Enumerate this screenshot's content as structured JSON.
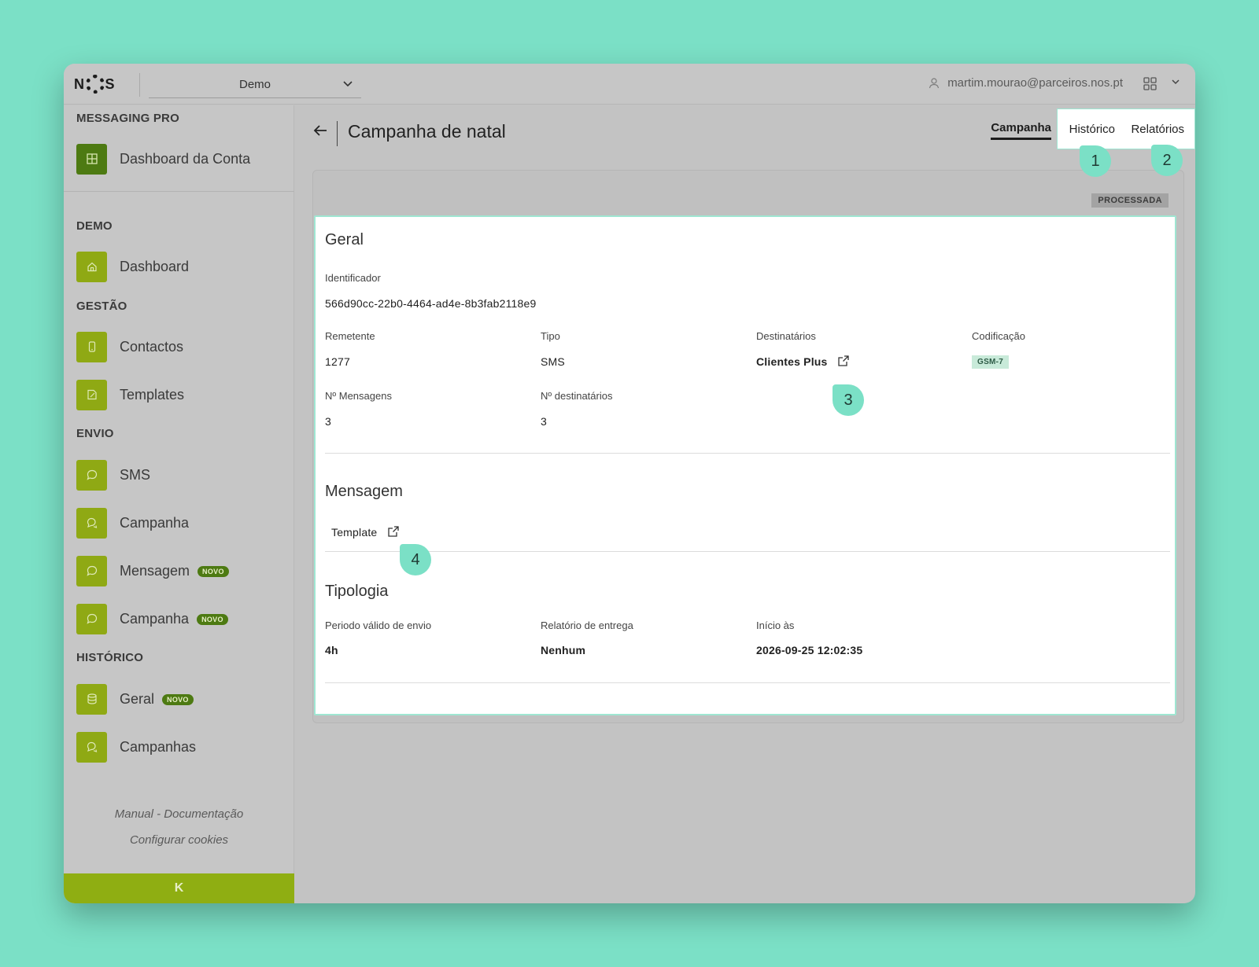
{
  "header": {
    "logo": "NOS",
    "account_select": "Demo",
    "user_email": "martim.mourao@parceiros.nos.pt"
  },
  "sidebar": {
    "top_section": "MESSAGING PRO",
    "dashboard_conta": "Dashboard da Conta",
    "demo_section": "DEMO",
    "dashboard": "Dashboard",
    "gestao_section": "GESTÃO",
    "contactos": "Contactos",
    "templates": "Templates",
    "envio_section": "ENVIO",
    "sms": "SMS",
    "campanha": "Campanha",
    "mensagem_novo": "Mensagem",
    "campanha_novo": "Campanha",
    "historico_section": "HISTÓRICO",
    "geral": "Geral",
    "campanhas": "Campanhas",
    "badge_novo": "NOVO",
    "manual_link": "Manual - Documentação",
    "cookies_link": "Configurar cookies",
    "collapse_glyph": "K"
  },
  "page": {
    "title": "Campanha de natal",
    "tabs": {
      "campanha": "Campanha",
      "historico": "Histórico",
      "relatorios": "Relatórios"
    },
    "status": "PROCESSADA"
  },
  "callouts": [
    "1",
    "2",
    "3",
    "4"
  ],
  "geral": {
    "heading": "Geral",
    "identificador_label": "Identificador",
    "identificador_value": "566d90cc-22b0-4464-ad4e-8b3fab2118e9",
    "remetente_label": "Remetente",
    "remetente_value": "1277",
    "tipo_label": "Tipo",
    "tipo_value": "SMS",
    "destinatarios_label": "Destinatários",
    "destinatarios_value": "Clientes Plus",
    "codificacao_label": "Codificação",
    "codificacao_value": "GSM-7",
    "n_mensagens_label": "Nº Mensagens",
    "n_mensagens_value": "3",
    "n_destinatarios_label": "Nº destinatários",
    "n_destinatarios_value": "3"
  },
  "mensagem": {
    "heading": "Mensagem",
    "template_link": "Template"
  },
  "tipologia": {
    "heading": "Tipologia",
    "periodo_label": "Periodo válido de envio",
    "periodo_value": "4h",
    "relatorio_label": "Relatório de entrega",
    "relatorio_value": "Nenhum",
    "inicio_label": "Início às",
    "inicio_value": "2026-09-25 12:02:35"
  },
  "colors": {
    "background": "#7be0c6",
    "accent_green": "#8fa914",
    "dark_green": "#4d7a12",
    "callout": "#7be0c6"
  },
  "icons": [
    "grid-icon",
    "home-icon",
    "phone-icon",
    "edit-icon",
    "chat-icon",
    "database-icon",
    "external-link-icon",
    "back-arrow-icon",
    "apps-icon",
    "user-icon",
    "chevron-down-icon"
  ]
}
